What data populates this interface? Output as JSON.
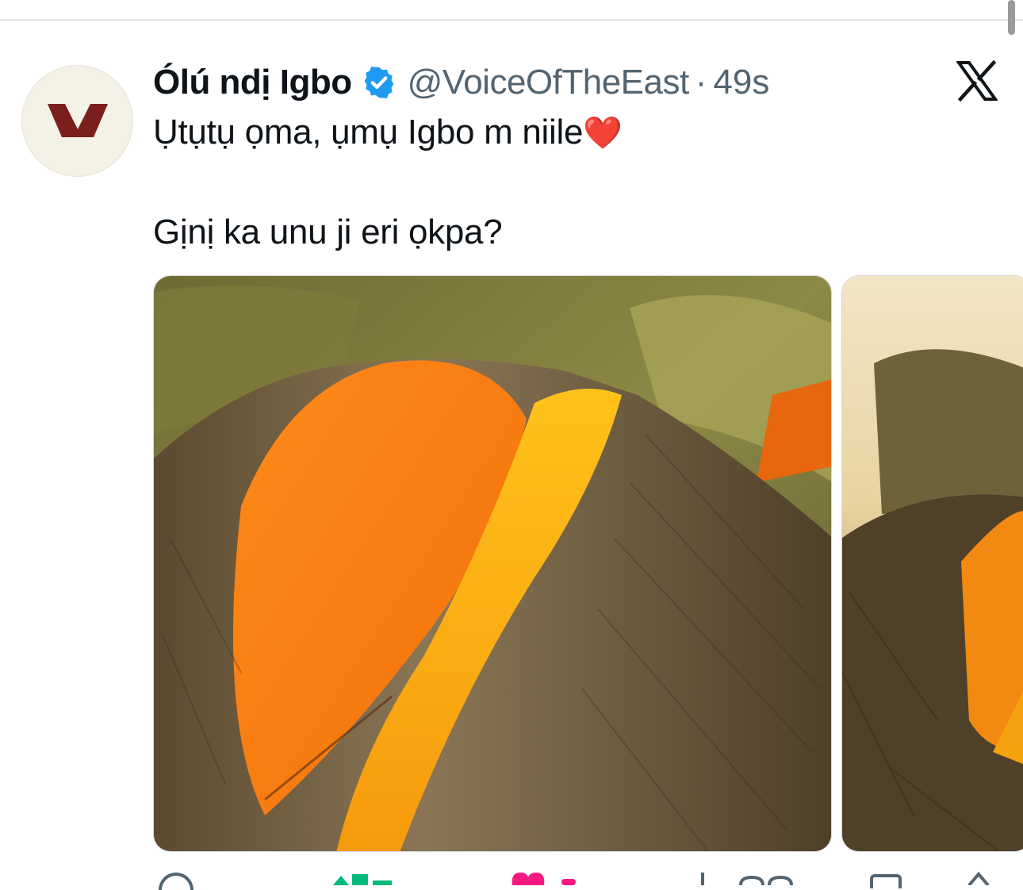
{
  "author": {
    "display_name": "Ólú ndị Igbo",
    "handle": "@VoiceOfTheEast",
    "separator": "·",
    "time": "49s",
    "verified": true,
    "avatar_icon": "v-logo-icon",
    "avatar_color": "#7a1f1c"
  },
  "tweet": {
    "line1": "Ụtụtụ ọma, ụmụ Igbo m niile",
    "emoji": "❤️",
    "line2": "Gịnị ka unu ji eri ọkpa?"
  },
  "media": [
    {
      "alt_icon": "okpa-photo-1"
    },
    {
      "alt_icon": "okpa-photo-2"
    }
  ],
  "colors": {
    "accent": "#1d9bf0",
    "muted": "#536471",
    "like": "#f91880",
    "retweet": "#00ba7c"
  },
  "icons": {
    "close": "x-logo-icon",
    "reply": "reply-icon",
    "retweet": "retweet-icon",
    "like": "like-icon",
    "views": "views-icon",
    "bookmark": "bookmark-icon",
    "share": "share-icon"
  }
}
